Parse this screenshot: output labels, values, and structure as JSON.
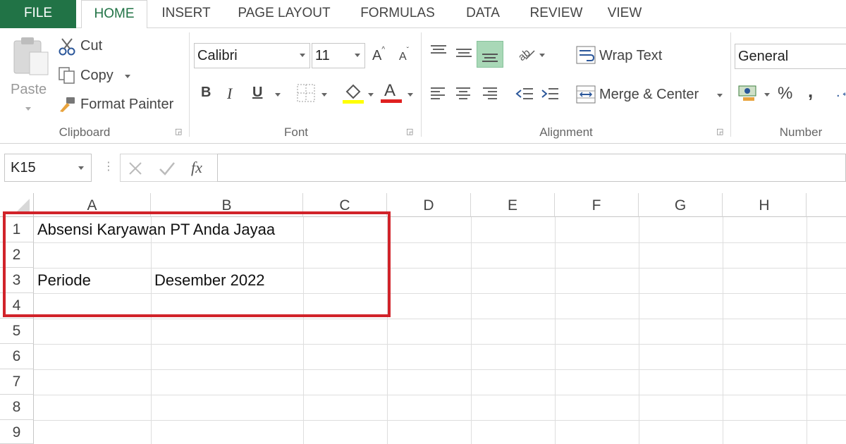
{
  "tabs": [
    "FILE",
    "HOME",
    "INSERT",
    "PAGE LAYOUT",
    "FORMULAS",
    "DATA",
    "REVIEW",
    "VIEW"
  ],
  "clipboard": {
    "paste": "Paste",
    "cut": "Cut",
    "copy": "Copy",
    "format_painter": "Format Painter",
    "label": "Clipboard"
  },
  "font": {
    "name": "Calibri",
    "size": "11",
    "bold": "B",
    "italic": "I",
    "underline": "U",
    "font_color_glyph": "A",
    "grow_glyph": "A",
    "shrink_glyph": "A",
    "highlight_color": "#ffff00",
    "text_color": "#e02020",
    "label": "Font"
  },
  "alignment": {
    "wrap_text": "Wrap Text",
    "merge_center": "Merge & Center",
    "label": "Alignment",
    "active_color": "#a9d8b7"
  },
  "number": {
    "format": "General",
    "percent": "%",
    "comma": ",",
    "label": "Number"
  },
  "formula_bar": {
    "name_box": "K15",
    "fx": "fx",
    "value": ""
  },
  "grid": {
    "columns": [
      "A",
      "B",
      "C",
      "D",
      "E",
      "F",
      "G",
      "H"
    ],
    "rows": [
      "1",
      "2",
      "3",
      "4",
      "5",
      "6",
      "7",
      "8",
      "9"
    ],
    "cells": {
      "A1": "Absensi Karyawan PT Anda Jayaa",
      "A3": "Periode",
      "B3": "Desember 2022"
    },
    "highlight_color": "#d1232a"
  }
}
